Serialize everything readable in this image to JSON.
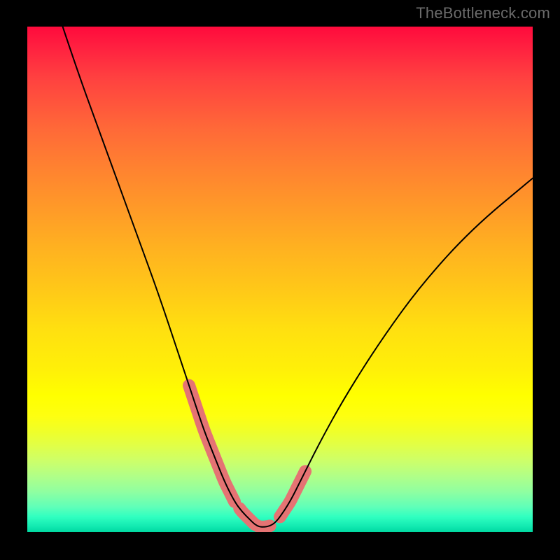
{
  "watermark": "TheBottleneck.com",
  "chart_data": {
    "type": "line",
    "title": "",
    "xlabel": "",
    "ylabel": "",
    "xlim": [
      0,
      100
    ],
    "ylim": [
      0,
      100
    ],
    "series": [
      {
        "name": "bottleneck-curve",
        "x": [
          7,
          10,
          14,
          18,
          22,
          26,
          30,
          33,
          35,
          37,
          39,
          41,
          42.5,
          44,
          45,
          46,
          47,
          48,
          49,
          50,
          52,
          54,
          58,
          63,
          70,
          78,
          88,
          100
        ],
        "y": [
          100,
          91,
          80,
          69,
          58,
          47,
          35,
          26,
          20,
          15,
          10,
          6,
          4,
          2.5,
          1.5,
          1,
          1,
          1.2,
          1.8,
          3,
          6,
          10,
          18,
          27,
          38,
          49,
          60,
          70
        ]
      }
    ],
    "highlight_segments": [
      {
        "name": "left-descent-highlight",
        "x_range": [
          32,
          41
        ],
        "color": "#e57373"
      },
      {
        "name": "valley-bottom-highlight",
        "x_range": [
          42,
          48
        ],
        "color": "#e57373"
      },
      {
        "name": "right-ascent-highlight",
        "x_range": [
          50,
          55
        ],
        "color": "#e57373"
      }
    ],
    "background_gradient": {
      "type": "vertical",
      "stops": [
        {
          "pos": 0.0,
          "color": "#ff0a3c"
        },
        {
          "pos": 0.36,
          "color": "#ff9a28"
        },
        {
          "pos": 0.73,
          "color": "#ffff00"
        },
        {
          "pos": 0.92,
          "color": "#90ffa0"
        },
        {
          "pos": 1.0,
          "color": "#00d8a0"
        }
      ]
    }
  }
}
